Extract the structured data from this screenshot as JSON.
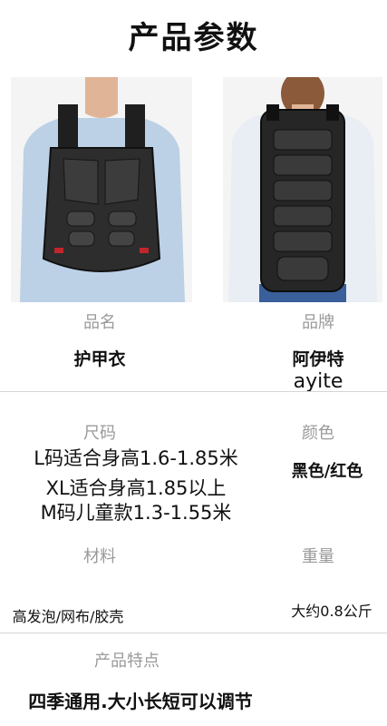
{
  "page_title": "产品参数",
  "product_name": {
    "label": "品名",
    "value": "护甲衣"
  },
  "brand": {
    "label": "品牌",
    "value_cn": "阿伊特",
    "value_en": "ayite"
  },
  "size": {
    "label": "尺码",
    "lines": [
      "L码适合身高1.6-1.85米",
      "XL适合身高1.85以上",
      "M码儿童款1.3-1.55米"
    ]
  },
  "color": {
    "label": "颜色",
    "value": "黑色/红色"
  },
  "material": {
    "label": "材料",
    "value": "高发泡/网布/胶壳"
  },
  "weight": {
    "label": "重量",
    "value": "大约0.8公斤"
  },
  "features": {
    "label": "产品特点",
    "value": "四季通用.大小长短可以调节"
  },
  "colors": {
    "vest": "#2a2a2a",
    "shirt": "#bcd0e6",
    "accent": "#c0262b"
  }
}
